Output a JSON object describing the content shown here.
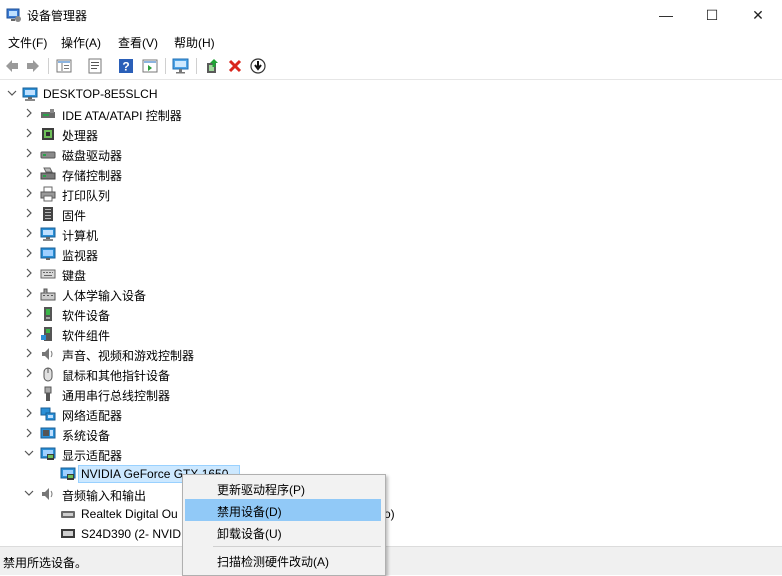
{
  "window": {
    "title": "设备管理器",
    "minimize_glyph": "—",
    "maximize_glyph": "☐",
    "close_glyph": "✕"
  },
  "menu": [
    "文件(F)",
    "操作(A)",
    "查看(V)",
    "帮助(H)"
  ],
  "toolbar": {
    "icons": [
      "back-icon",
      "forward-icon",
      "show-hide-tree-icon",
      "properties-icon",
      "help-icon",
      "action-pane-icon",
      "scan-hardware-icon",
      "update-driver-icon",
      "uninstall-icon",
      "disable-icon"
    ]
  },
  "tree": {
    "root": "DESKTOP-8E5SLCH",
    "categories": [
      {
        "label": "IDE ATA/ATAPI 控制器",
        "icon": "ide-controller-icon"
      },
      {
        "label": "处理器",
        "icon": "processor-icon"
      },
      {
        "label": "磁盘驱动器",
        "icon": "disk-drive-icon"
      },
      {
        "label": "存储控制器",
        "icon": "storage-controller-icon"
      },
      {
        "label": "打印队列",
        "icon": "print-queue-icon"
      },
      {
        "label": "固件",
        "icon": "firmware-icon"
      },
      {
        "label": "计算机",
        "icon": "computer-icon"
      },
      {
        "label": "监视器",
        "icon": "monitor-icon"
      },
      {
        "label": "键盘",
        "icon": "keyboard-icon"
      },
      {
        "label": "人体学输入设备",
        "icon": "hid-icon"
      },
      {
        "label": "软件设备",
        "icon": "software-device-icon"
      },
      {
        "label": "软件组件",
        "icon": "software-component-icon"
      },
      {
        "label": "声音、视频和游戏控制器",
        "icon": "sound-icon"
      },
      {
        "label": "鼠标和其他指针设备",
        "icon": "mouse-icon"
      },
      {
        "label": "通用串行总线控制器",
        "icon": "usb-icon"
      },
      {
        "label": "网络适配器",
        "icon": "network-adapter-icon"
      },
      {
        "label": "系统设备",
        "icon": "system-device-icon"
      },
      {
        "label": "显示适配器",
        "icon": "display-adapter-icon"
      },
      {
        "label": "音频输入和输出",
        "icon": "audio-io-icon"
      }
    ],
    "display_child": "NVIDIA GeForce GTX 1650",
    "audio_children": [
      "Realtek Digital Ou",
      "S24D390 (2- NVID"
    ],
    "audio_child_tail": "o)"
  },
  "context_menu": {
    "items": [
      "更新驱动程序(P)",
      "禁用设备(D)",
      "卸载设备(U)",
      "扫描检测硬件改动(A)"
    ],
    "highlighted_index": 1
  },
  "status": "禁用所选设备。",
  "colors": {
    "selection_bg": "#cce8ff",
    "menu_highlight": "#91c9f7",
    "uninstall_red": "#d9261c",
    "monitor_blue": "#2b8fd6"
  }
}
